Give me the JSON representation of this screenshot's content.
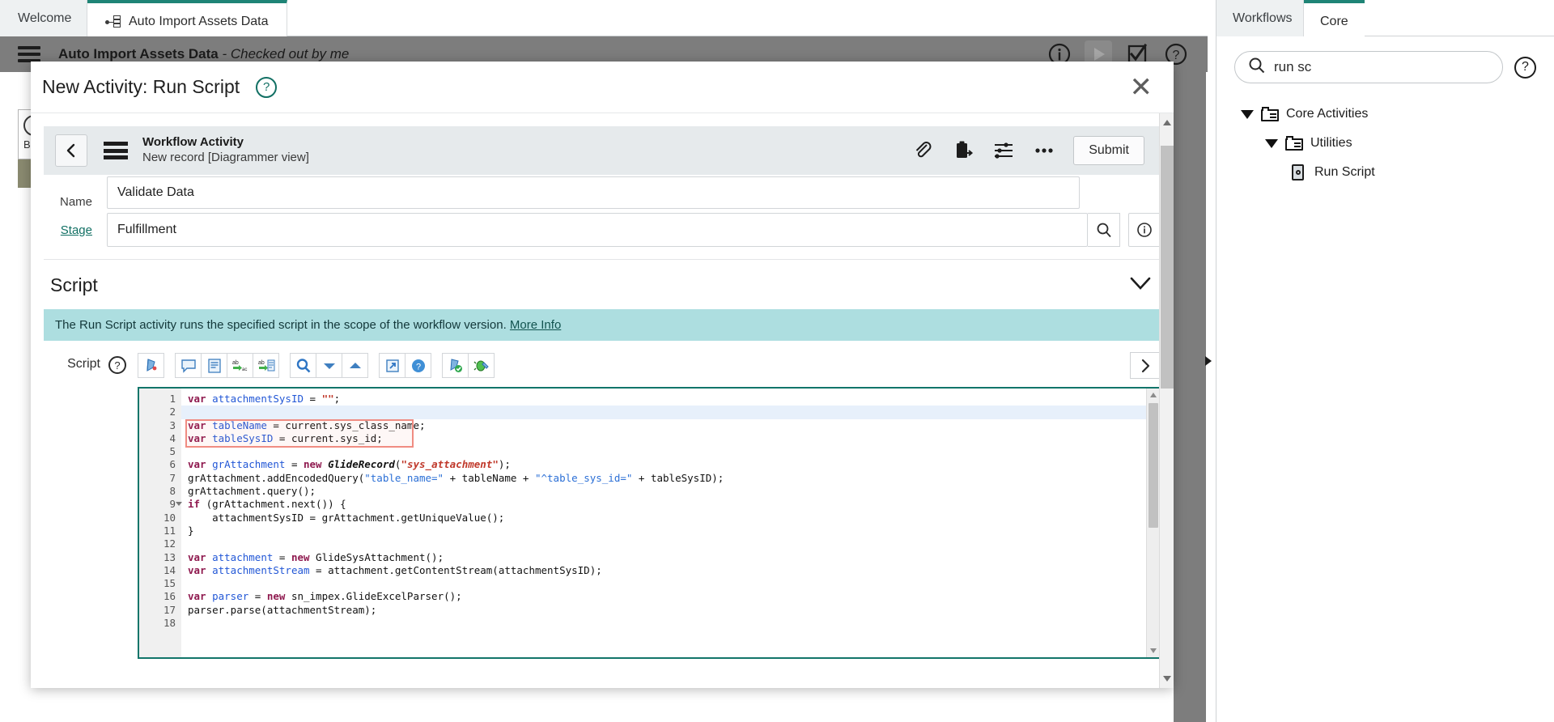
{
  "window": {
    "tabs": [
      {
        "label": "Welcome",
        "active": false,
        "icon": "none"
      },
      {
        "label": "Auto Import Assets Data",
        "active": true,
        "icon": "workflow-icon"
      }
    ]
  },
  "app_header": {
    "menu_icon": "hamburger-menu-icon",
    "title": "Auto Import Assets Data",
    "subtitle": "- Checked out by me",
    "actions": [
      {
        "name": "info-icon",
        "glyph": "i"
      },
      {
        "name": "run-play-icon",
        "glyph": "play"
      },
      {
        "name": "validate-check-icon",
        "glyph": "check"
      },
      {
        "name": "help-icon",
        "glyph": "?"
      }
    ]
  },
  "modal": {
    "title": "New Activity: Run Script",
    "help_icon": "help-circle-icon",
    "close_icon": "close-icon",
    "record_bar": {
      "back_icon": "chevron-left-icon",
      "menu_icon": "hamburger-menu-icon",
      "title": "Workflow Activity",
      "subtitle": "New record [Diagrammer view]",
      "icons": [
        {
          "name": "attachment-paperclip-icon"
        },
        {
          "name": "copy-clipboard-icon"
        },
        {
          "name": "personalize-sliders-icon"
        },
        {
          "name": "more-options-icon"
        }
      ],
      "submit_label": "Submit"
    },
    "fields": [
      {
        "label": "Name",
        "value": "Validate Data",
        "name": "name-field",
        "has_lookup": false,
        "is_link": false
      },
      {
        "label": "Stage",
        "value": "Fulfillment",
        "name": "stage-field",
        "has_lookup": true,
        "is_link": true
      }
    ],
    "section": {
      "title": "Script",
      "collapse_icon": "chevron-down-icon"
    },
    "banner": {
      "text": "The Run Script activity runs the specified script in the scope of the workflow version.",
      "link": "More Info"
    },
    "editor": {
      "label": "Script",
      "help_icon": "help-circle-icon",
      "toolbar": [
        {
          "name": "format-script-icon",
          "group": 0
        },
        {
          "name": "comment-bubble-icon",
          "group": 1
        },
        {
          "name": "toggle-lines-icon",
          "group": 1
        },
        {
          "name": "replace-icon",
          "group": 1
        },
        {
          "name": "replace-all-icon",
          "group": 1
        },
        {
          "name": "search-icon",
          "group": 2
        },
        {
          "name": "jump-down-icon",
          "group": 2
        },
        {
          "name": "jump-up-icon",
          "group": 2
        },
        {
          "name": "open-external-icon",
          "group": 3
        },
        {
          "name": "help-blue-icon",
          "group": 3
        },
        {
          "name": "syntax-check-icon",
          "group": 4
        },
        {
          "name": "debug-bug-icon",
          "group": 4
        }
      ],
      "next_icon": "chevron-right-icon",
      "highlight_lines": [
        3,
        4
      ],
      "lines": [
        {
          "n": 1,
          "fold": false,
          "hl": false,
          "tokens": [
            {
              "t": "var",
              "c": "kw"
            },
            {
              "t": " ",
              "c": ""
            },
            {
              "t": "attachmentSysID",
              "c": "vr"
            },
            {
              "t": " = ",
              "c": ""
            },
            {
              "t": "\"\"",
              "c": "str"
            },
            {
              "t": ";",
              "c": ""
            }
          ]
        },
        {
          "n": 2,
          "fold": false,
          "hl": true,
          "tokens": []
        },
        {
          "n": 3,
          "fold": false,
          "hl": false,
          "tokens": [
            {
              "t": "var",
              "c": "kw"
            },
            {
              "t": " ",
              "c": ""
            },
            {
              "t": "tableName",
              "c": "vr"
            },
            {
              "t": " = current.sys_class_name;",
              "c": ""
            }
          ]
        },
        {
          "n": 4,
          "fold": false,
          "hl": false,
          "tokens": [
            {
              "t": "var",
              "c": "kw"
            },
            {
              "t": " ",
              "c": ""
            },
            {
              "t": "tableSysID",
              "c": "vr"
            },
            {
              "t": " = current.sys_id;",
              "c": ""
            }
          ]
        },
        {
          "n": 5,
          "fold": false,
          "hl": false,
          "tokens": []
        },
        {
          "n": 6,
          "fold": false,
          "hl": false,
          "tokens": [
            {
              "t": "var",
              "c": "kw"
            },
            {
              "t": " ",
              "c": ""
            },
            {
              "t": "grAttachment",
              "c": "vr"
            },
            {
              "t": " = ",
              "c": ""
            },
            {
              "t": "new",
              "c": "kw"
            },
            {
              "t": " ",
              "c": ""
            },
            {
              "t": "GlideRecord",
              "c": "cls"
            },
            {
              "t": "(",
              "c": ""
            },
            {
              "t": "\"sys_attachment\"",
              "c": "str"
            },
            {
              "t": ");",
              "c": ""
            }
          ]
        },
        {
          "n": 7,
          "fold": false,
          "hl": false,
          "tokens": [
            {
              "t": "grAttachment.addEncodedQuery(",
              "c": ""
            },
            {
              "t": "\"table_name=\"",
              "c": "str2"
            },
            {
              "t": " + tableName + ",
              "c": ""
            },
            {
              "t": "\"^table_sys_id=\"",
              "c": "str2"
            },
            {
              "t": " + tableSysID);",
              "c": ""
            }
          ]
        },
        {
          "n": 8,
          "fold": false,
          "hl": false,
          "tokens": [
            {
              "t": "grAttachment.query();",
              "c": ""
            }
          ]
        },
        {
          "n": 9,
          "fold": true,
          "hl": false,
          "tokens": [
            {
              "t": "if",
              "c": "kw"
            },
            {
              "t": " (grAttachment.next()) {",
              "c": ""
            }
          ]
        },
        {
          "n": 10,
          "fold": false,
          "hl": false,
          "tokens": [
            {
              "t": "    attachmentSysID = grAttachment.getUniqueValue();",
              "c": ""
            }
          ]
        },
        {
          "n": 11,
          "fold": false,
          "hl": false,
          "tokens": [
            {
              "t": "}",
              "c": ""
            }
          ]
        },
        {
          "n": 12,
          "fold": false,
          "hl": false,
          "tokens": []
        },
        {
          "n": 13,
          "fold": false,
          "hl": false,
          "tokens": [
            {
              "t": "var",
              "c": "kw"
            },
            {
              "t": " ",
              "c": ""
            },
            {
              "t": "attachment",
              "c": "vr"
            },
            {
              "t": " = ",
              "c": ""
            },
            {
              "t": "new",
              "c": "kw"
            },
            {
              "t": " GlideSysAttachment();",
              "c": ""
            }
          ]
        },
        {
          "n": 14,
          "fold": false,
          "hl": false,
          "tokens": [
            {
              "t": "var",
              "c": "kw"
            },
            {
              "t": " ",
              "c": ""
            },
            {
              "t": "attachmentStream",
              "c": "vr"
            },
            {
              "t": " = attachment.getContentStream(attachmentSysID);",
              "c": ""
            }
          ]
        },
        {
          "n": 15,
          "fold": false,
          "hl": false,
          "tokens": []
        },
        {
          "n": 16,
          "fold": false,
          "hl": false,
          "tokens": [
            {
              "t": "var",
              "c": "kw"
            },
            {
              "t": " ",
              "c": ""
            },
            {
              "t": "parser",
              "c": "vr"
            },
            {
              "t": " = ",
              "c": ""
            },
            {
              "t": "new",
              "c": "kw"
            },
            {
              "t": " sn_impex.GlideExcelParser();",
              "c": ""
            }
          ]
        },
        {
          "n": 17,
          "fold": false,
          "hl": false,
          "tokens": [
            {
              "t": "parser.parse(attachmentStream);",
              "c": ""
            }
          ]
        },
        {
          "n": 18,
          "fold": false,
          "hl": false,
          "tokens": []
        }
      ]
    }
  },
  "palette": {
    "tabs": [
      {
        "label": "Workflows",
        "active": false
      },
      {
        "label": "Core",
        "active": true
      }
    ],
    "search": {
      "value": "run sc",
      "placeholder": "",
      "icon": "search-icon"
    },
    "help_icon": "help-circle-icon",
    "tree": [
      {
        "label": "Core Activities",
        "level": 1,
        "type": "folder",
        "expanded": true
      },
      {
        "label": "Utilities",
        "level": 2,
        "type": "folder",
        "expanded": true
      },
      {
        "label": "Run Script",
        "level": 3,
        "type": "script",
        "expanded": false
      }
    ]
  },
  "colors": {
    "accent_teal": "#1f8476",
    "banner_bg": "#addee0",
    "editor_border": "#12756a",
    "highlight_box": "#f08c82",
    "header_grey": "#7d7d7d"
  }
}
